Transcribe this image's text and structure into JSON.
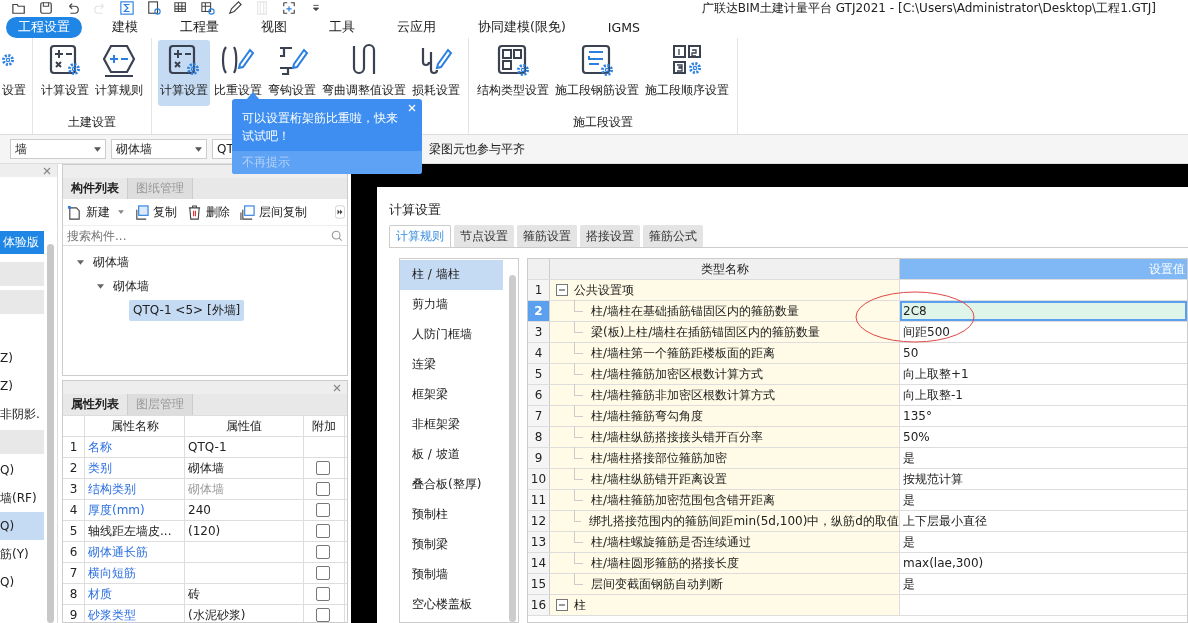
{
  "quick_access": [
    {
      "kind": "open",
      "disabled": false
    },
    {
      "kind": "save",
      "disabled": false
    },
    {
      "kind": "undo",
      "disabled": false
    },
    {
      "kind": "redo",
      "disabled": true
    },
    {
      "kind": "sum",
      "disabled": false
    },
    {
      "kind": "report",
      "disabled": false
    },
    {
      "kind": "grid",
      "disabled": false
    },
    {
      "kind": "find",
      "disabled": false
    },
    {
      "kind": "edit",
      "disabled": false
    },
    {
      "kind": "film",
      "disabled": true
    },
    {
      "kind": "select",
      "disabled": false
    },
    {
      "kind": "more",
      "disabled": false
    }
  ],
  "window": {
    "title": "广联达BIM土建计量平台 GTJ2021 - [C:\\Users\\Administrator\\Desktop\\工程1.GTJ]"
  },
  "menu_tabs": [
    {
      "label": "工程设置",
      "selected": true
    },
    {
      "label": "建模",
      "selected": false
    },
    {
      "label": "工程量",
      "selected": false
    },
    {
      "label": "视图",
      "selected": false
    },
    {
      "label": "工具",
      "selected": false
    },
    {
      "label": "云应用",
      "selected": false
    },
    {
      "label": "协同建模(限免)",
      "selected": false
    },
    {
      "label": "IGMS",
      "selected": false
    }
  ],
  "ribbon": {
    "groups": [
      {
        "buttons": [
          {
            "label": "设置",
            "kind": "gear",
            "selected": false
          }
        ]
      },
      {
        "label": "土建设置",
        "buttons": [
          {
            "label": "计算设置",
            "kind": "calc",
            "selected": false
          },
          {
            "label": "计算规则",
            "kind": "rules",
            "selected": false
          }
        ]
      },
      {
        "buttons": [
          {
            "label": "计算设置",
            "kind": "calc",
            "selected": true
          },
          {
            "label": "比重设置",
            "kind": "weight",
            "selected": false
          },
          {
            "label": "弯钩设置",
            "kind": "hook",
            "selected": false
          },
          {
            "label": "弯曲调整值设置",
            "kind": "bend",
            "selected": false
          },
          {
            "label": "损耗设置",
            "kind": "loss",
            "selected": false
          }
        ]
      },
      {
        "label": "施工段设置",
        "buttons": [
          {
            "label": "结构类型设置",
            "kind": "structure",
            "selected": false
          },
          {
            "label": "施工段钢筋设置",
            "kind": "segment",
            "selected": false
          },
          {
            "label": "施工段顺序设置",
            "kind": "order",
            "selected": false
          }
        ]
      }
    ]
  },
  "filter_bar": {
    "combos": [
      {
        "value": "墙"
      },
      {
        "value": "砌体墙"
      },
      {
        "value": "QT"
      }
    ],
    "note": "梁图元也参与平齐"
  },
  "tooltip": {
    "text": "可以设置桁架筋比重啦，快来试试吧！",
    "dismiss": "不再提示"
  },
  "left_panel": {
    "badge": "体验版",
    "rows": [
      {
        "kind": "header"
      },
      {
        "kind": "header"
      },
      {
        "kind": "spacer"
      },
      {
        "kind": "item",
        "text": "Z)",
        "selected": false
      },
      {
        "kind": "item",
        "text": "Z)",
        "selected": false
      },
      {
        "kind": "item",
        "text": "非阴影.",
        "selected": false
      },
      {
        "kind": "header"
      },
      {
        "kind": "item",
        "text": "Q)",
        "selected": false
      },
      {
        "kind": "item",
        "text": "墙(RF)",
        "selected": false
      },
      {
        "kind": "item",
        "text": "Q)",
        "selected": true
      },
      {
        "kind": "item",
        "text": "筋(Y)",
        "selected": false
      },
      {
        "kind": "item",
        "text": "Q)",
        "selected": false
      }
    ]
  },
  "component_panel": {
    "tabs": [
      {
        "label": "构件列表",
        "selected": true
      },
      {
        "label": "图纸管理",
        "selected": false
      }
    ],
    "actions": [
      {
        "label": "新建",
        "kind": "new",
        "dropdown": true
      },
      {
        "label": "复制",
        "kind": "copy",
        "dropdown": false
      },
      {
        "label": "删除",
        "kind": "delete",
        "dropdown": false
      },
      {
        "label": "层间复制",
        "kind": "floor-copy",
        "dropdown": false
      }
    ],
    "search": {
      "placeholder": "搜索构件..."
    },
    "tree": [
      {
        "label": "砌体墙",
        "expanded": true,
        "selected": false,
        "children": [
          {
            "label": "砌体墙",
            "expanded": true,
            "selected": false,
            "children": [
              {
                "label": "QTQ-1 <5> [外墙]",
                "selected": true
              }
            ]
          }
        ]
      }
    ]
  },
  "property_panel": {
    "tabs": [
      {
        "label": "属性列表",
        "selected": true
      },
      {
        "label": "图层管理",
        "selected": false
      }
    ],
    "columns": [
      "属性名称",
      "属性值",
      "附加"
    ],
    "rows": [
      {
        "number": "1",
        "name": "名称",
        "value": "QTQ-1",
        "linked": true,
        "disabled": false,
        "kind": "plain"
      },
      {
        "number": "2",
        "name": "类别",
        "value": "砌体墙",
        "linked": true,
        "disabled": false,
        "kind": "checkbox",
        "checked": false
      },
      {
        "number": "3",
        "name": "结构类别",
        "value": "砌体墙",
        "linked": true,
        "disabled": true,
        "kind": "checkbox",
        "checked": false
      },
      {
        "number": "4",
        "name": "厚度(mm)",
        "value": "240",
        "linked": true,
        "disabled": false,
        "kind": "checkbox",
        "checked": false
      },
      {
        "number": "5",
        "name": "轴线距左墙皮...",
        "value": "(120)",
        "linked": false,
        "disabled": false,
        "kind": "checkbox",
        "checked": false
      },
      {
        "number": "6",
        "name": "砌体通长筋",
        "linked": true,
        "disabled": false,
        "kind": "checkbox",
        "checked": false
      },
      {
        "number": "7",
        "name": "横向短筋",
        "linked": true,
        "disabled": false,
        "kind": "checkbox",
        "checked": false
      },
      {
        "number": "8",
        "name": "材质",
        "value": "砖",
        "linked": true,
        "disabled": false,
        "kind": "checkbox",
        "checked": false
      },
      {
        "number": "9",
        "name": "砂浆类型",
        "value": "(水泥砂浆)",
        "linked": true,
        "disabled": false,
        "kind": "checkbox",
        "checked": false
      }
    ]
  },
  "dialog": {
    "title": "计算设置",
    "tabs": [
      {
        "label": "计算规则",
        "selected": true
      },
      {
        "label": "节点设置",
        "selected": false
      },
      {
        "label": "箍筋设置",
        "selected": false
      },
      {
        "label": "搭接设置",
        "selected": false
      },
      {
        "label": "箍筋公式",
        "selected": false
      }
    ],
    "categories": [
      {
        "label": "柱 / 墙柱",
        "selected": true
      },
      {
        "label": "剪力墙",
        "selected": false
      },
      {
        "label": "人防门框墙",
        "selected": false
      },
      {
        "label": "连梁",
        "selected": false
      },
      {
        "label": "框架梁",
        "selected": false
      },
      {
        "label": "非框架梁",
        "selected": false
      },
      {
        "label": "板 / 坡道",
        "selected": false
      },
      {
        "label": "叠合板(整厚)",
        "selected": false
      },
      {
        "label": "预制柱",
        "selected": false
      },
      {
        "label": "预制梁",
        "selected": false
      },
      {
        "label": "预制墙",
        "selected": false
      },
      {
        "label": "空心楼盖板",
        "selected": false
      }
    ],
    "table": {
      "columns": [
        "类型名称",
        "设置值"
      ],
      "rows": [
        {
          "number": "1",
          "kind": "group",
          "name": "公共设置项",
          "expanded": true,
          "selected": false
        },
        {
          "number": "2",
          "kind": "setting",
          "name": "柱/墙柱在基础插筋锚固区内的箍筋数量",
          "value": "2C8",
          "selected": true
        },
        {
          "number": "3",
          "kind": "setting",
          "name": "梁(板)上柱/墙柱在插筋锚固区内的箍筋数量",
          "value": "间距500",
          "selected": false
        },
        {
          "number": "4",
          "kind": "setting",
          "name": "柱/墙柱第一个箍筋距楼板面的距离",
          "value": "50",
          "selected": false
        },
        {
          "number": "5",
          "kind": "setting",
          "name": "柱/墙柱箍筋加密区根数计算方式",
          "value": "向上取整+1",
          "selected": false
        },
        {
          "number": "6",
          "kind": "setting",
          "name": "柱/墙柱箍筋非加密区根数计算方式",
          "value": "向上取整-1",
          "selected": false
        },
        {
          "number": "7",
          "kind": "setting",
          "name": "柱/墙柱箍筋弯勾角度",
          "value": "135°",
          "selected": false
        },
        {
          "number": "8",
          "kind": "setting",
          "name": "柱/墙柱纵筋搭接接头错开百分率",
          "value": "50%",
          "selected": false
        },
        {
          "number": "9",
          "kind": "setting",
          "name": "柱/墙柱搭接部位箍筋加密",
          "value": "是",
          "selected": false
        },
        {
          "number": "10",
          "kind": "setting",
          "name": "柱/墙柱纵筋错开距离设置",
          "value": "按规范计算",
          "selected": false
        },
        {
          "number": "11",
          "kind": "setting",
          "name": "柱/墙柱箍筋加密范围包含错开距离",
          "value": "是",
          "selected": false
        },
        {
          "number": "12",
          "kind": "setting",
          "name": "绑扎搭接范围内的箍筋间距min(5d,100)中，纵筋d的取值",
          "value": "上下层最小直径",
          "selected": false
        },
        {
          "number": "13",
          "kind": "setting",
          "name": "柱/墙柱螺旋箍筋是否连续通过",
          "value": "是",
          "selected": false
        },
        {
          "number": "14",
          "kind": "setting",
          "name": "柱/墙柱圆形箍筋的搭接长度",
          "value": "max(lae,300)",
          "selected": false
        },
        {
          "number": "15",
          "kind": "setting",
          "name": "层间变截面钢筋自动判断",
          "value": "是",
          "selected": false
        },
        {
          "number": "16",
          "kind": "group",
          "name": "柱",
          "expanded": true,
          "selected": false
        }
      ]
    }
  }
}
